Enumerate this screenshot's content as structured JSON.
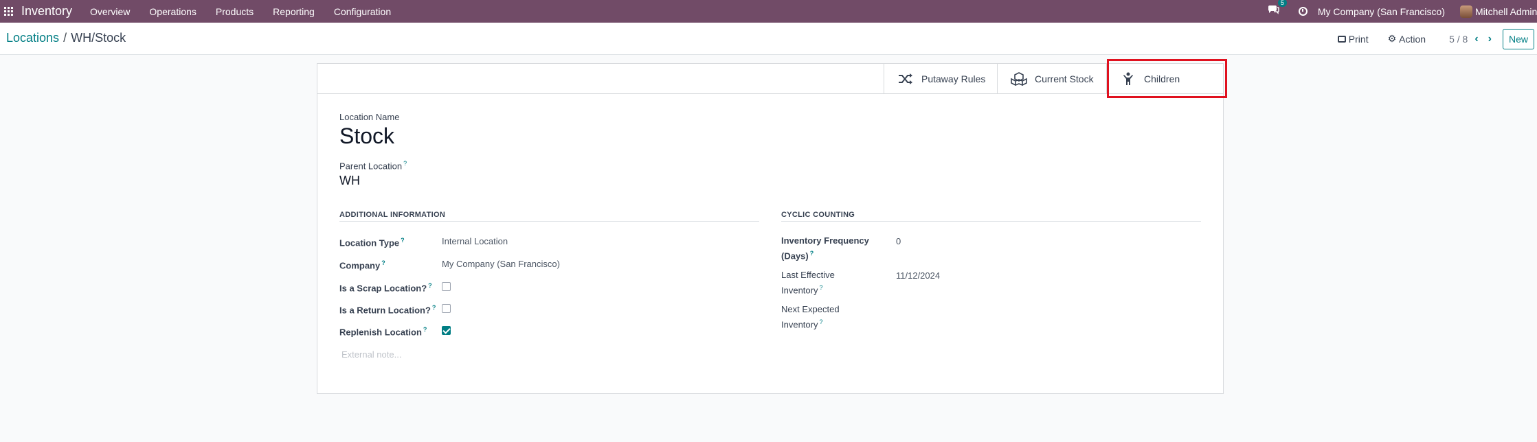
{
  "navbar": {
    "app_name": "Inventory",
    "menu": [
      "Overview",
      "Operations",
      "Products",
      "Reporting",
      "Configuration"
    ],
    "chat_count": "5",
    "company": "My Company (San Francisco)",
    "user": "Mitchell Admin"
  },
  "control": {
    "breadcrumb_parent": "Locations",
    "breadcrumb_current": "WH/Stock",
    "print_label": "Print",
    "action_label": "Action",
    "pager": "5 / 8",
    "new_label": "New"
  },
  "smart_buttons": {
    "putaway": "Putaway Rules",
    "current_stock": "Current Stock",
    "children": "Children"
  },
  "form": {
    "location_name_label": "Location Name",
    "location_name": "Stock",
    "parent_label": "Parent Location",
    "parent_value": "WH",
    "additional_title": "ADDITIONAL INFORMATION",
    "location_type_label": "Location Type",
    "location_type_value": "Internal Location",
    "company_label": "Company",
    "company_value": "My Company (San Francisco)",
    "scrap_label": "Is a Scrap Location?",
    "return_label": "Is a Return Location?",
    "replenish_label": "Replenish Location",
    "scrap_checked": false,
    "return_checked": false,
    "replenish_checked": true,
    "note_placeholder": "External note...",
    "cyclic_title": "CYCLIC COUNTING",
    "freq_label_1": "Inventory Frequency",
    "freq_label_2": "(Days)",
    "freq_value": "0",
    "last_label_1": "Last Effective",
    "last_label_2": "Inventory",
    "last_value": "11/12/2024",
    "next_label_1": "Next Expected",
    "next_label_2": "Inventory",
    "help_mark": "?"
  },
  "colors": {
    "navbar": "#714b67",
    "accent": "#017e84",
    "highlight": "#e0111f"
  }
}
